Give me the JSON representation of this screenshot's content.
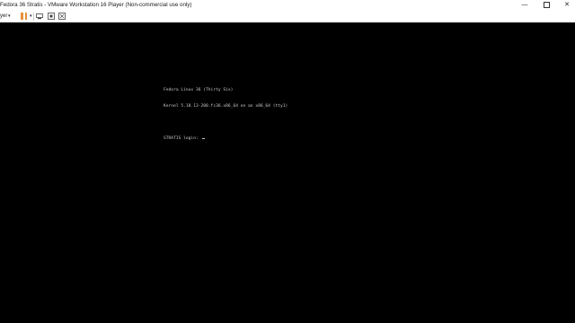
{
  "window": {
    "title": "Fedora 36 Stratis - VMware Workstation 16 Player (Non-commercial use only)",
    "minimize_glyph": "—",
    "close_glyph": "✕"
  },
  "toolbar": {
    "player_menu": "yer",
    "caret": "▾",
    "pause_color": "#e69138",
    "icons": [
      "send-ctrl-alt-del-icon",
      "removable-devices-icon",
      "fullscreen-icon"
    ]
  },
  "console": {
    "os_line": "Fedora Linux 36 (Thirty Six)",
    "kernel_line": "Kernel 5.18.13-200.fc36.x86_64 on an x86_64 (tty1)",
    "login_prompt": "STRATIS login: "
  }
}
